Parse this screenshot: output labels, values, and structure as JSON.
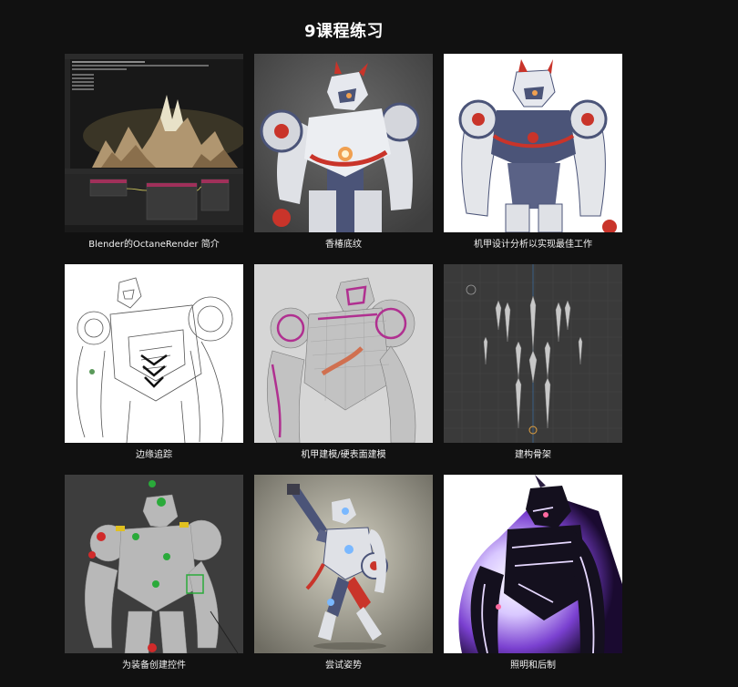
{
  "page": {
    "title": "9课程练习"
  },
  "lessons": [
    {
      "caption": "Blender的OctaneRender 简介",
      "thumb_icon": "blender-octane-screenshot"
    },
    {
      "caption": "香椿底纹",
      "thumb_icon": "robot-render-gray"
    },
    {
      "caption": "机甲设计分析以实现最佳工作",
      "thumb_icon": "robot-render-white"
    },
    {
      "caption": "边缘追踪",
      "thumb_icon": "line-art-robot"
    },
    {
      "caption": "机甲建模/硬表面建模",
      "thumb_icon": "wireframe-robot"
    },
    {
      "caption": "建构骨架",
      "thumb_icon": "skeleton-rig"
    },
    {
      "caption": "为装备创建控件",
      "thumb_icon": "rig-controls-robot"
    },
    {
      "caption": "尝试姿势",
      "thumb_icon": "posed-robot"
    },
    {
      "caption": "照明和后制",
      "thumb_icon": "lighting-robot"
    }
  ],
  "colors": {
    "background": "#111111",
    "caption_text": "#f2f2f2",
    "accent_red": "#d0362a",
    "mech_navy": "#4b5478"
  }
}
